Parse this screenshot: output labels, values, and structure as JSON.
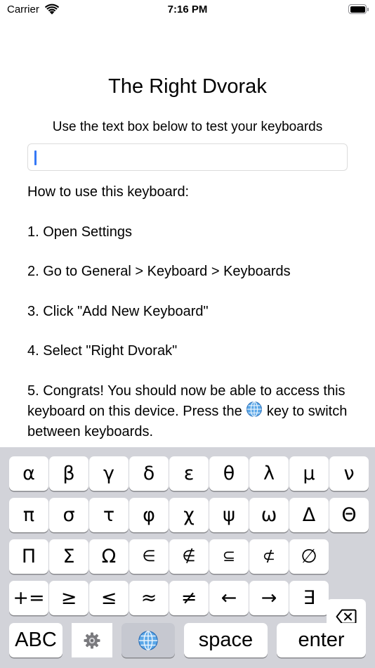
{
  "status_bar": {
    "carrier": "Carrier",
    "time": "7:16 PM"
  },
  "app": {
    "title": "The Right Dvorak",
    "subtitle": "Use the text box below to test your keyboards",
    "test_input": {
      "value": "",
      "placeholder": ""
    }
  },
  "instructions": {
    "heading": "How to use this keyboard:",
    "step1": "1. Open Settings",
    "step2": "2. Go to General > Keyboard > Keyboards",
    "step3": "3. Click \"Add New Keyboard\"",
    "step4": "4. Select \"Right Dvorak\"",
    "step5_a": "5. Congrats! You should now be able to access this keyboard on this device. Press the",
    "step5_b": "key to switch between keyboards."
  },
  "keyboard": {
    "row1": [
      "α",
      "β",
      "γ",
      "δ",
      "ε",
      "θ",
      "λ",
      "μ",
      "ν"
    ],
    "row2": [
      "π",
      "σ",
      "τ",
      "φ",
      "χ",
      "ψ",
      "ω",
      "Δ",
      "Θ"
    ],
    "row3": [
      "Π",
      "Σ",
      "Ω",
      "∈",
      "∉",
      "⊆",
      "⊄",
      "∅"
    ],
    "row4": [
      "+=",
      "≥",
      "≤",
      "≈",
      "≠",
      "←",
      "→",
      "∃"
    ],
    "abc_label": "ABC",
    "space_label": "space",
    "enter_label": "enter",
    "icons": {
      "delete": "backspace-icon",
      "settings": "gear-icon",
      "globe": "globe-icon"
    },
    "key_color": "#ffffff",
    "background_color": "#d2d3d9"
  }
}
